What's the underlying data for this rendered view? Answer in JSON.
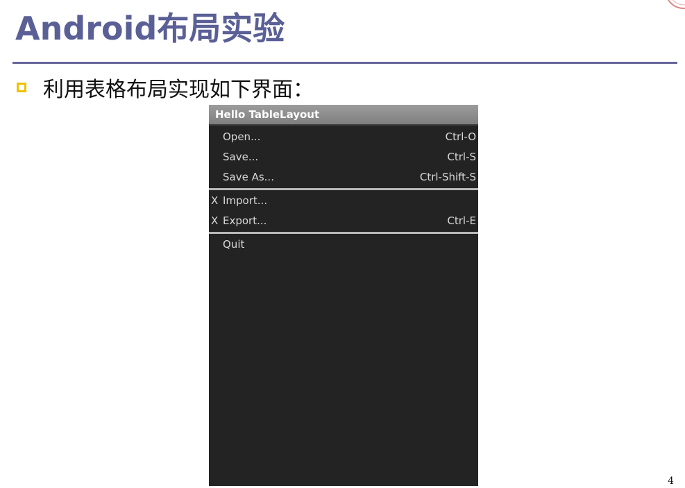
{
  "slide": {
    "title": "Android布局实验",
    "bullet_text": "利用表格布局实现如下界面：",
    "page_number": "4"
  },
  "colors": {
    "title": "#5a5f96",
    "rule": "#66669a",
    "bullet": "#f2c000",
    "phone_background": "#232323",
    "app_titlebar": "#8c8c8c"
  },
  "phone": {
    "app_title": "Hello TableLayout",
    "groups": [
      {
        "rows": [
          {
            "mark": "",
            "label": "Open...",
            "shortcut": "Ctrl-O"
          },
          {
            "mark": "",
            "label": "Save...",
            "shortcut": "Ctrl-S"
          },
          {
            "mark": "",
            "label": "Save As...",
            "shortcut": "Ctrl-Shift-S"
          }
        ]
      },
      {
        "rows": [
          {
            "mark": "X",
            "label": "Import...",
            "shortcut": ""
          },
          {
            "mark": "X",
            "label": "Export...",
            "shortcut": "Ctrl-E"
          }
        ]
      },
      {
        "rows": [
          {
            "mark": "",
            "label": "Quit",
            "shortcut": ""
          }
        ]
      }
    ]
  }
}
